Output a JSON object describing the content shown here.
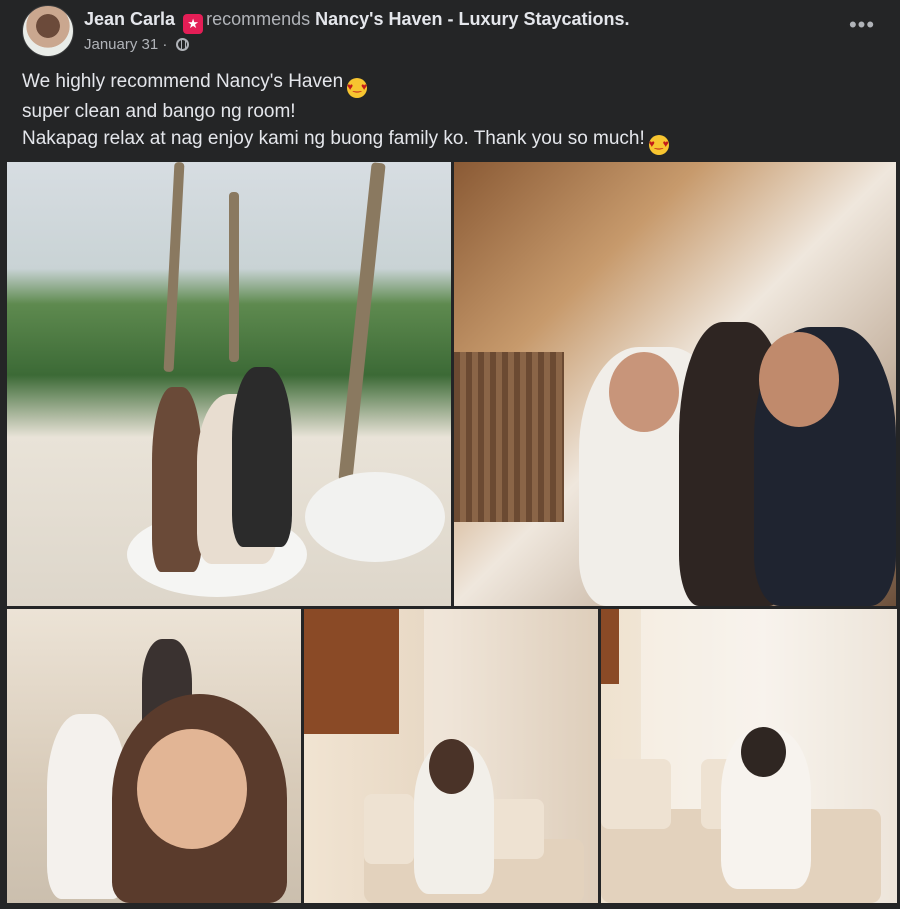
{
  "post": {
    "author": "Jean Carla",
    "recommends_text": "recommends",
    "page_name": "Nancy's Haven - Luxury Staycations.",
    "date": "January 31",
    "date_separator": "·",
    "audience_icon": "globe-icon",
    "more_options": "•••",
    "caption_lines": [
      "We highly recommend Nancy's Haven",
      "super clean and bango ng room!",
      "Nakapag relax at nag enjoy kami ng buong family ko.  Thank you so much!"
    ],
    "emoji": "heart-eyes-emoji",
    "photo_count": 5
  },
  "colors": {
    "background": "#242526",
    "text_primary": "#e4e6eb",
    "text_secondary": "#b0b3b8",
    "recommend_icon": "#e41e56"
  }
}
